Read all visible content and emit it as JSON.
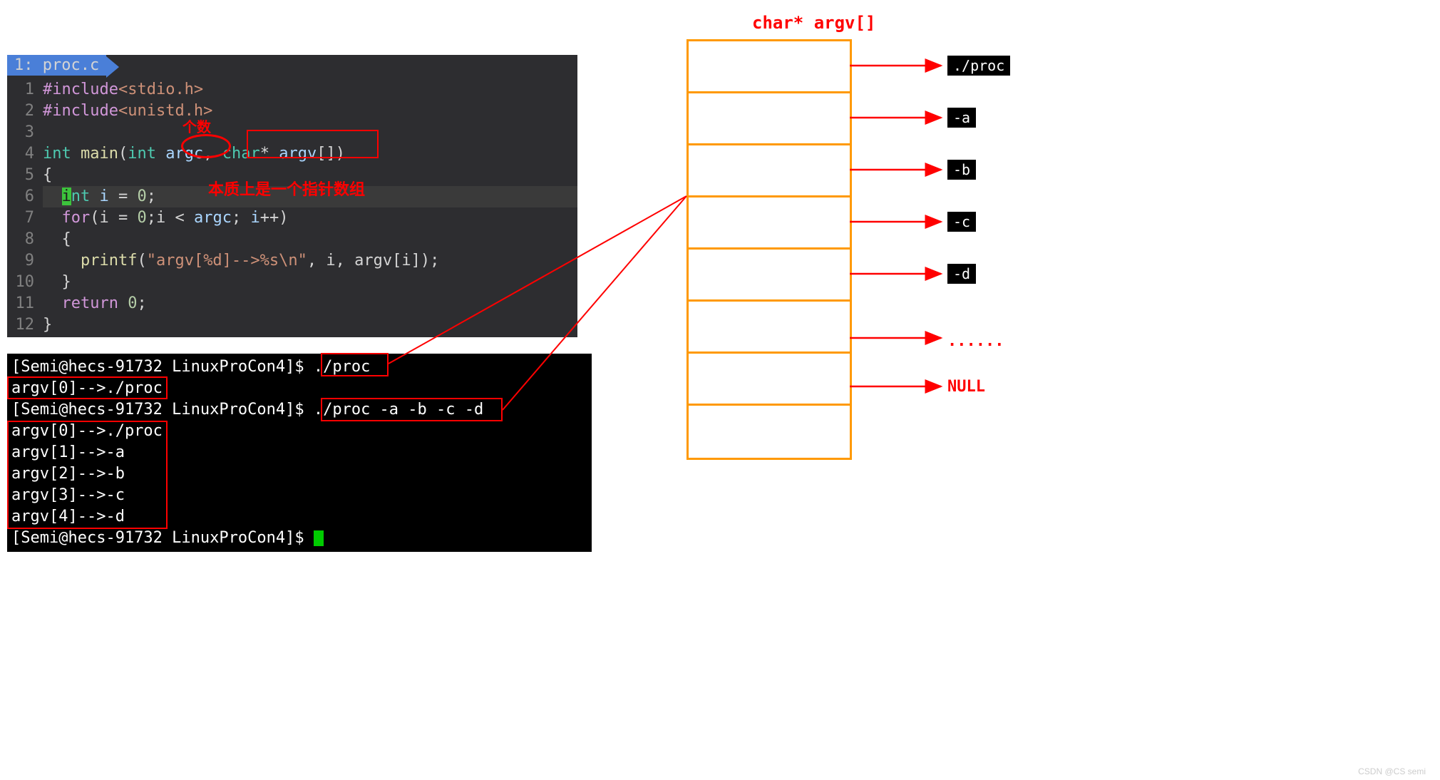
{
  "editor": {
    "tab_num": "1:",
    "tab_file": "proc.c",
    "lines": [
      {
        "n": "1",
        "pink1": "#include",
        "rest": "<stdio.h>"
      },
      {
        "n": "2",
        "pink1": "#include",
        "rest": "<unistd.h>"
      },
      {
        "n": "3"
      },
      {
        "n": "4",
        "type1": "int",
        "func": "main",
        "p1": "(",
        "type2": "int",
        "var1": "argc",
        "sep1": ", ",
        "type3": "char",
        "ptr": "* ",
        "var2": "argv",
        "arr": "[]",
        "p2": ")"
      },
      {
        "n": "5",
        "brace": "{"
      },
      {
        "n": "6",
        "cursor1": "  ",
        "i_hl": "i",
        "cursor2": "nt ",
        "var": "i ",
        "eq": "= ",
        "num": "0",
        "semi": ";"
      },
      {
        "n": "7",
        "indent": "  ",
        "kw": "for",
        "p1": "(i ",
        "eq1": "= ",
        "num1": "0",
        "semi1": ";i ",
        "lt": "< ",
        "var1": "argc",
        "semi2": "; ",
        "var2": "i",
        "inc": "++",
        "p2": ")"
      },
      {
        "n": "8",
        "indent": "  ",
        "brace": "{"
      },
      {
        "n": "9",
        "indent": "    ",
        "func": "printf",
        "p1": "(",
        "str": "\"argv[%d]-->%s\\n\"",
        "sep": ", i, argv[i]);"
      },
      {
        "n": "10",
        "indent": "  ",
        "brace": "}"
      },
      {
        "n": "11",
        "indent": "  ",
        "kw": "return",
        "sp": " ",
        "num": "0",
        "semi": ";"
      },
      {
        "n": "12",
        "brace": "}"
      }
    ]
  },
  "annotations": {
    "geshu": "个数",
    "zhizhen": "本质上是一个指针数组"
  },
  "terminal": {
    "lines": [
      {
        "prompt": "[Semi@hecs-91732 LinuxProCon4]$ ",
        "cmd": "./proc"
      },
      {
        "out": "argv[0]-->./proc"
      },
      {
        "prompt": "[Semi@hecs-91732 LinuxProCon4]$ ",
        "cmd": "./proc -a -b -c -d"
      },
      {
        "out": "argv[0]-->./proc"
      },
      {
        "out": "argv[1]-->-a"
      },
      {
        "out": "argv[2]-->-b"
      },
      {
        "out": "argv[3]-->-c"
      },
      {
        "out": "argv[4]-->-d"
      },
      {
        "prompt": "[Semi@hecs-91732 LinuxProCon4]$ ",
        "cursor": true
      }
    ]
  },
  "argv_diagram": {
    "title": "char* argv[]",
    "cells": 8,
    "labels": [
      "./proc",
      "-a",
      "-b",
      "-c",
      "-d",
      "......",
      "NULL"
    ]
  },
  "watermark": "CSDN @CS semi"
}
